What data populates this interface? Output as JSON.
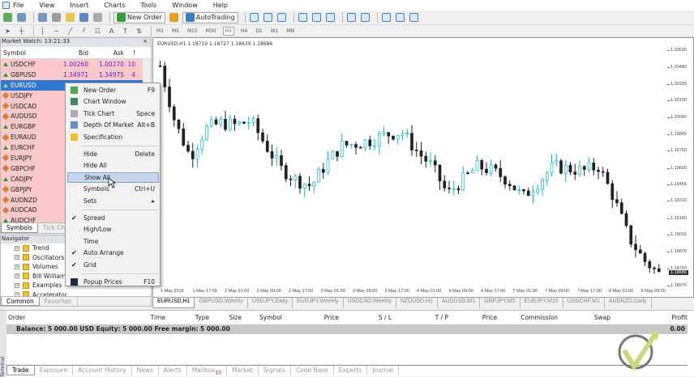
{
  "menubar": [
    "File",
    "View",
    "Insert",
    "Charts",
    "Tools",
    "Window",
    "Help"
  ],
  "toolbar": {
    "new_order": "New Order",
    "autotrading": "AutoTrading",
    "timeframes": [
      "M1",
      "M5",
      "M15",
      "M30",
      "H1",
      "H4",
      "D1",
      "W1",
      "MN"
    ],
    "active_tf": "H1"
  },
  "market_watch": {
    "title": "Market Watch: 13:21:33",
    "headers": [
      "Symbol",
      "Bid",
      "Ask",
      "!"
    ],
    "rows": [
      {
        "symbol": "USDCHF",
        "dir": "up",
        "bid": "1.00260",
        "ask": "1.00270",
        "spread": "10"
      },
      {
        "symbol": "GBPUSD",
        "dir": "up",
        "bid": "1.34971",
        "ask": "1.34975",
        "spread": "4"
      },
      {
        "symbol": "EURUSD",
        "dir": "up",
        "selected": true
      },
      {
        "symbol": "USDJPY",
        "dir": "down"
      },
      {
        "symbol": "USDCAD",
        "dir": "down"
      },
      {
        "symbol": "AUDUSD",
        "dir": "down"
      },
      {
        "symbol": "EURGBP",
        "dir": "up"
      },
      {
        "symbol": "EURAUD",
        "dir": "down"
      },
      {
        "symbol": "EURCHF",
        "dir": "up"
      },
      {
        "symbol": "EURJPY",
        "dir": "down"
      },
      {
        "symbol": "GBPCHF",
        "dir": "down"
      },
      {
        "symbol": "CADJPY",
        "dir": "up"
      },
      {
        "symbol": "GBPJPY",
        "dir": "down"
      },
      {
        "symbol": "AUDNZD",
        "dir": "down"
      },
      {
        "symbol": "AUDCAD",
        "dir": "down"
      },
      {
        "symbol": "AUDCHF",
        "dir": "up"
      }
    ],
    "tabs": [
      "Symbols",
      "Tick Chart"
    ]
  },
  "navigator": {
    "title": "Navigator",
    "items": [
      "Trend",
      "Oscillators",
      "Volumes",
      "Bill Williams",
      "Examples",
      "Accelerator"
    ],
    "tabs": [
      "Common",
      "Favorites"
    ]
  },
  "context_menu": [
    {
      "label": "New Order",
      "shortcut": "F9",
      "icon": "new-order-icon"
    },
    {
      "label": "Chart Window",
      "shortcut": "",
      "icon": "chart-window-icon"
    },
    {
      "label": "Tick Chart",
      "shortcut": "Space",
      "icon": "tick-chart-icon"
    },
    {
      "label": "Depth Of Market",
      "shortcut": "Alt+B",
      "icon": "depth-of-market-icon"
    },
    {
      "label": "Specification",
      "shortcut": "",
      "icon": "specification-icon"
    },
    {
      "sep": true
    },
    {
      "label": "Hide",
      "shortcut": "Delete"
    },
    {
      "label": "Hide All",
      "shortcut": ""
    },
    {
      "label": "Show All",
      "shortcut": "",
      "highlighted": true
    },
    {
      "label": "Symbols",
      "shortcut": "Ctrl+U"
    },
    {
      "label": "Sets",
      "shortcut": "▸"
    },
    {
      "sep": true
    },
    {
      "label": "Spread",
      "checked": true
    },
    {
      "label": "High/Low"
    },
    {
      "label": "Time"
    },
    {
      "label": "Auto Arrange",
      "checked": true
    },
    {
      "label": "Grid",
      "checked": true
    },
    {
      "sep": true
    },
    {
      "label": "Popup Prices",
      "shortcut": "F10",
      "icon": "popup-prices-icon"
    }
  ],
  "chart": {
    "title": "EURUSD,H1  1.18719 1.18727 1.18639 1.18686",
    "current_price": "1.18686",
    "price_labels": [
      "1.20630",
      "1.20480",
      "1.20335",
      "1.20190",
      "1.20040",
      "1.19895",
      "1.19750",
      "1.19600",
      "1.19455",
      "1.19310",
      "1.19160",
      "1.19015",
      "1.18870",
      "1.18720",
      "1.18570"
    ],
    "price_range": [
      1.1857,
      1.2063
    ],
    "time_labels": [
      "1 May 2018",
      "1 May 17:00",
      "2 May 01:00",
      "2 May 09:00",
      "2 May 17:00",
      "3 May 01:00",
      "3 May 09:00",
      "3 May 17:00",
      "4 May 01:00",
      "4 May 09:00",
      "4 May 17:00",
      "7 May 01:00",
      "7 May 09:00",
      "7 May 17:00",
      "8 May 01:00",
      "8 May 09:00"
    ],
    "price_path": [
      1.205,
      1.2,
      1.197,
      1.1995,
      1.2,
      1.1998,
      1.2002,
      1.198,
      1.196,
      1.195,
      1.1945,
      1.1965,
      1.198,
      1.1982,
      1.1985,
      1.199,
      1.1992,
      1.1975,
      1.1962,
      1.1938,
      1.195,
      1.1962,
      1.1958,
      1.195,
      1.1935,
      1.1948,
      1.1962,
      1.196,
      1.1958,
      1.1962,
      1.1935,
      1.19,
      1.188,
      1.1868
    ],
    "tabs": [
      "EURUSD,H1",
      "GBPUSD,Weekly",
      "USDJPY,Daily",
      "EURJPY,Weekly",
      "USDCAD,Weekly",
      "NZDUSD,H1",
      "AUDUSD,M1",
      "GBPJPY,M5",
      "EURJPY,M15",
      "USDCHF,M1",
      "AUDNZD,Daily"
    ]
  },
  "terminal": {
    "side_label": "Terminal",
    "headers": [
      "Order",
      "Time",
      "Type",
      "Size",
      "Symbol",
      "Price",
      "S / L",
      "T / P",
      "Price",
      "Commission",
      "Swap",
      "Profit"
    ],
    "balance": "Balance: 5 000.00 USD  Equity: 5 000.00  Free margin: 5 000.00",
    "profit": "0.00",
    "tabs": [
      "Trade",
      "Exposure",
      "Account History",
      "News",
      "Alerts",
      "Mailbox",
      "Market",
      "Signals",
      "Code Base",
      "Experts",
      "Journal"
    ],
    "mailbox_badge": "10"
  },
  "colors": {
    "row_bg": "#fbc9c9",
    "selected": "#2f77d0",
    "bull": "#00bcd4",
    "bear": "#222222"
  }
}
